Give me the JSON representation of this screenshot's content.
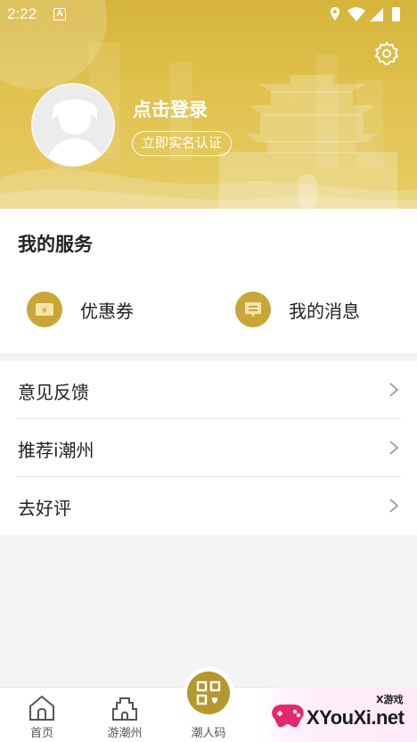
{
  "status_bar": {
    "time": "2:22",
    "badge": "A"
  },
  "profile": {
    "login_text": "点击登录",
    "verify_label": "立即实名认证"
  },
  "services": {
    "title": "我的服务",
    "items": [
      {
        "label": "优惠券",
        "icon": "coupon-icon"
      },
      {
        "label": "我的消息",
        "icon": "message-icon"
      }
    ]
  },
  "menu": [
    {
      "label": "意见反馈"
    },
    {
      "label": "推荐i潮州"
    },
    {
      "label": "去好评"
    }
  ],
  "bottom_nav": [
    {
      "label": "首页",
      "icon": "home-icon"
    },
    {
      "label": "游潮州",
      "icon": "pagoda-icon"
    },
    {
      "label": "潮人码",
      "icon": "qr-code-icon"
    }
  ],
  "watermark": {
    "brand": "XYouXi.net",
    "sub": "X游戏"
  },
  "colors": {
    "accent": "#d6b43c",
    "icon_gold": "#c9a637"
  }
}
